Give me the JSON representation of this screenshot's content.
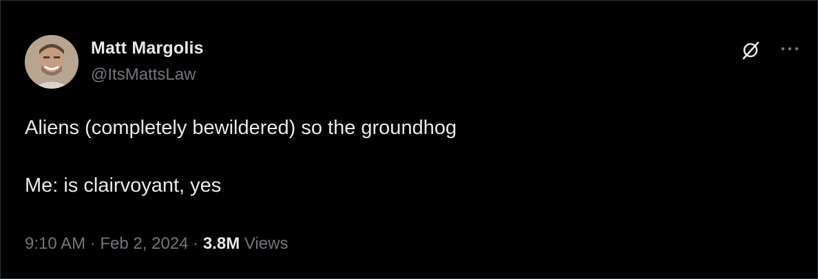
{
  "author": {
    "display_name": "Matt Margolis",
    "handle": "@ItsMattsLaw"
  },
  "tweet": {
    "lines": [
      "Aliens (completely bewildered) so the groundhog",
      "Me: is clairvoyant, yes"
    ]
  },
  "meta": {
    "time": "9:10 AM",
    "sep1": " · ",
    "date": "Feb 2, 2024",
    "sep2": " · ",
    "views_count": "3.8M",
    "views_label": " Views"
  },
  "icons": {
    "grok": "grok-icon",
    "more": "more-options-icon"
  },
  "colors": {
    "background": "#000000",
    "primary_text": "#e7e9ea",
    "secondary_text": "#71767b",
    "border": "#2f3336"
  }
}
